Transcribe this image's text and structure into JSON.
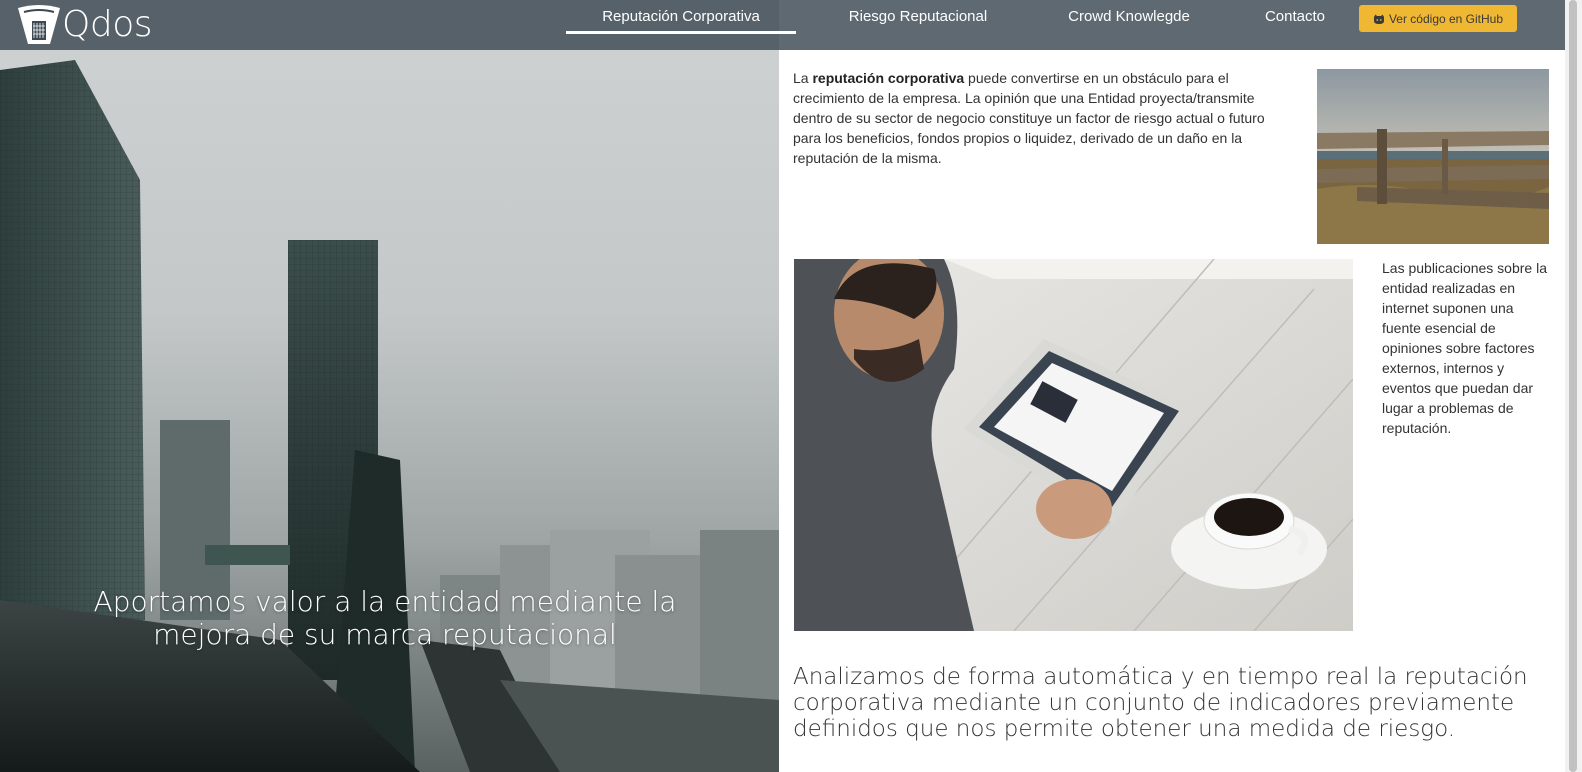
{
  "brand": {
    "name": "Qdos"
  },
  "nav": {
    "items": [
      {
        "label": "Reputación Corporativa",
        "active": true
      },
      {
        "label": "Riesgo Reputacional",
        "active": false
      },
      {
        "label": "Crowd Knowlegde",
        "active": false
      },
      {
        "label": "Contacto",
        "active": false
      }
    ],
    "github_button": {
      "label": "Ver código en GitHub",
      "icon": "github-icon"
    }
  },
  "hero": {
    "tagline": "Aportamos valor a la entidad mediante la mejora de su marca reputacional"
  },
  "content": {
    "intro": {
      "prefix": "La ",
      "bold": "reputación corporativa",
      "rest": " puede convertirse en un obstáculo para el crecimiento de la empresa. La opinión que una Entidad proyecta/transmite dentro de su sector de negocio constituye un factor de riesgo actual o futuro para los beneficios, fondos propios o liquidez, derivado de un daño en la reputación de la misma."
    },
    "publications": "Las publicaciones sobre la entidad realizadas en internet suponen una fuente esencial de opiniones sobre factores externos, internos y eventos que puedan dar lugar a problemas de reputación.",
    "headline": "Analizamos de forma automática y en tiempo real la reputación corporativa mediante un conjunto de indicadores previamente definidos que nos permite obtener una medida de riesgo."
  },
  "colors": {
    "navbar": "#3c4852",
    "accent": "#f0b732",
    "text": "#333333"
  }
}
